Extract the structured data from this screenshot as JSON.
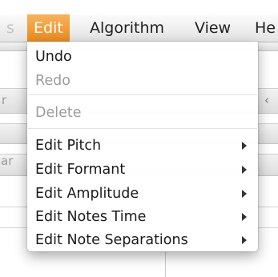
{
  "menubar": {
    "items": [
      {
        "label": "s"
      },
      {
        "label": "Edit"
      },
      {
        "label": "Algorithm"
      },
      {
        "label": "View"
      },
      {
        "label": "He"
      }
    ]
  },
  "background": {
    "fragments": [
      "r",
      "ar"
    ]
  },
  "edit_menu": {
    "undo": "Undo",
    "redo": "Redo",
    "delete": "Delete",
    "edit_pitch": "Edit Pitch",
    "edit_formant": "Edit Formant",
    "edit_amplitude": "Edit Amplitude",
    "edit_notes_time": "Edit Notes Time",
    "edit_note_separations": "Edit Note Separations"
  },
  "colors": {
    "accent": "#ee901f",
    "disabled_text": "#9c9c9c"
  }
}
